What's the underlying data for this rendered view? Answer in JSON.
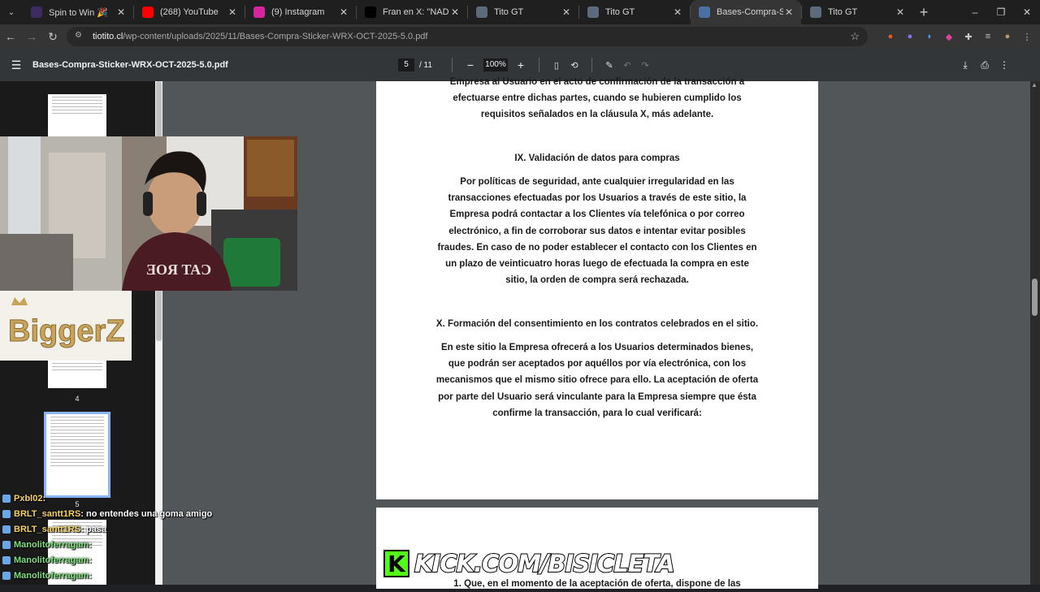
{
  "browser": {
    "tabs": [
      {
        "title": "Spin to Win 🎉",
        "icon_color": "#3b2b5f",
        "icon": "kick-icon"
      },
      {
        "title": "(268) YouTube",
        "icon_color": "#ff0000",
        "icon": "youtube-icon"
      },
      {
        "title": "(9) Instagram",
        "icon_color": "#d6249f",
        "icon": "instagram-icon"
      },
      {
        "title": "Fran en X: \"NADIE SE GAN",
        "icon_color": "#000000",
        "icon": "x-icon"
      },
      {
        "title": "Tito GT",
        "icon_color": "#5b6b7b",
        "icon": "site-icon"
      },
      {
        "title": "Tito GT",
        "icon_color": "#5b6b7b",
        "icon": "site-icon"
      },
      {
        "title": "Bases-Compra-Sticker-W",
        "icon_color": "#4a6fa5",
        "icon": "pdf-icon",
        "active": true
      },
      {
        "title": "Tito GT",
        "icon_color": "#5b6b7b",
        "icon": "site-icon"
      }
    ],
    "url_domain": "tiotito.cl",
    "url_path": "/wp-content/uploads/2025/11/Bases-Compra-Sticker-WRX-OCT-2025-5.0.pdf"
  },
  "pdf": {
    "filename": "Bases-Compra-Sticker-WRX-OCT-2025-5.0.pdf",
    "current_page": "5",
    "total_pages": "/ 11",
    "zoom": "100%",
    "thumb_labels": [
      "4",
      "5"
    ]
  },
  "document": {
    "intro_lines": [
      "Empresa al Usuario en el acto de confirmación de la transacción a",
      "efectuarse entre dichas partes, cuando se hubieren cumplido los",
      "requisitos señalados en la cláusula X, más adelante."
    ],
    "section9_title": "IX. Validación de datos para compras",
    "section9_lines": [
      "Por políticas de seguridad, ante cualquier irregularidad en las",
      "transacciones efectuadas por los Usuarios a través de este sitio, la",
      "Empresa podrá contactar a los Clientes vía telefónica o por correo",
      "electrónico, a fin de corroborar sus datos e intentar evitar posibles",
      "fraudes. En caso de no poder establecer el contacto con los Clientes en",
      "un plazo de veinticuatro horas luego de efectuada la compra en este",
      "sitio, la orden de compra será rechazada."
    ],
    "section10_title": "X. Formación del consentimiento en los contratos celebrados en el sitio.",
    "section10_lines": [
      "En este sitio la Empresa ofrecerá a los Usuarios determinados bienes,",
      "que podrán ser aceptados por aquéllos por vía electrónica, con los",
      "mecanismos que el mismo sitio ofrece para ello. La aceptación de oferta",
      "por parte del Usuario será vinculante para la Empresa siempre que ésta",
      "confirme la transacción, para lo cual verificará:"
    ],
    "next_page_line": "1.  Que, en el momento de la aceptación de oferta, dispone de las"
  },
  "overlay": {
    "logo_text": "BiggerZ",
    "chat": [
      {
        "user": "Pxbl02",
        "text": " : ",
        "color": "#f6d365"
      },
      {
        "user": "BRLT_santt1RS",
        "text": " : no entendes una goma amigo",
        "color": "#f6d365"
      },
      {
        "user": "BRLT_santt1RS",
        "text": " : pasa",
        "color": "#f6d365"
      },
      {
        "user": "Manolitoferragam",
        "text": " : ",
        "color": "#7fe07f"
      },
      {
        "user": "Manolitoferragam",
        "text": " : ",
        "color": "#7fe07f"
      },
      {
        "user": "Manolitoferragam",
        "text": " : ",
        "color": "#7fe07f"
      }
    ],
    "kick_url": "KICK.COM/BISICLETA"
  }
}
